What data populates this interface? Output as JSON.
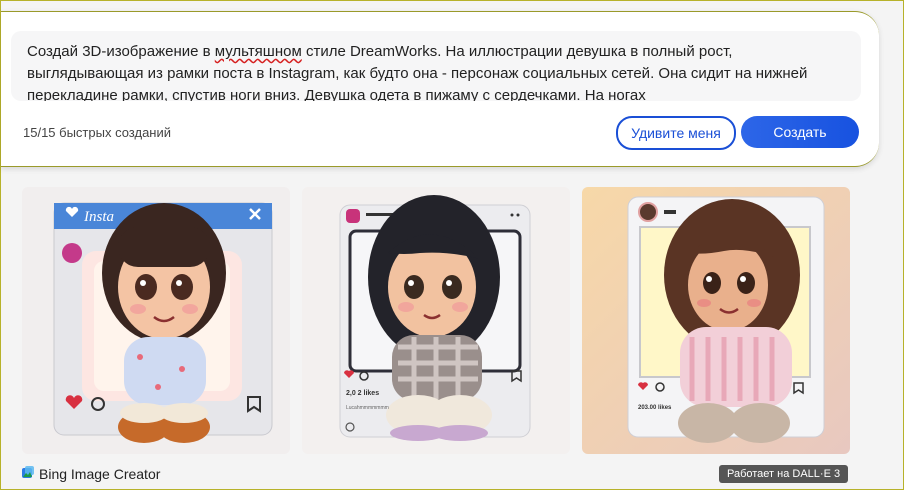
{
  "prompt": {
    "text_before": "Создай 3D-изображение в ",
    "misspelled_word": "мультяшном",
    "text_after": " стиле DreamWorks. На иллюстрации девушка в полный рост, выглядывающая из рамки поста в Instagram, как будто она - персонаж социальных сетей. Она сидит на нижней перекладине рамки, спустив ноги вниз. Девушка одета в пижаму с сердечками. На ногах"
  },
  "counter": "15/15 быстрых созданий",
  "buttons": {
    "surprise": "Удивите меня",
    "create": "Создать"
  },
  "images": [
    {
      "frame_title": "Insta",
      "likes": "",
      "caption": ""
    },
    {
      "frame_title": "",
      "likes": "2,0 2 likes",
      "caption": "Lucahmmmmmmm"
    },
    {
      "frame_title": "",
      "likes": "203.00 likes",
      "caption": ""
    }
  ],
  "footer": {
    "brand": "Bing Image Creator",
    "badge": "Работает на DALL·E 3"
  },
  "colors": {
    "accent": "#1a4fd6",
    "create_button": "#1752e0",
    "badge_bg": "#555555"
  }
}
